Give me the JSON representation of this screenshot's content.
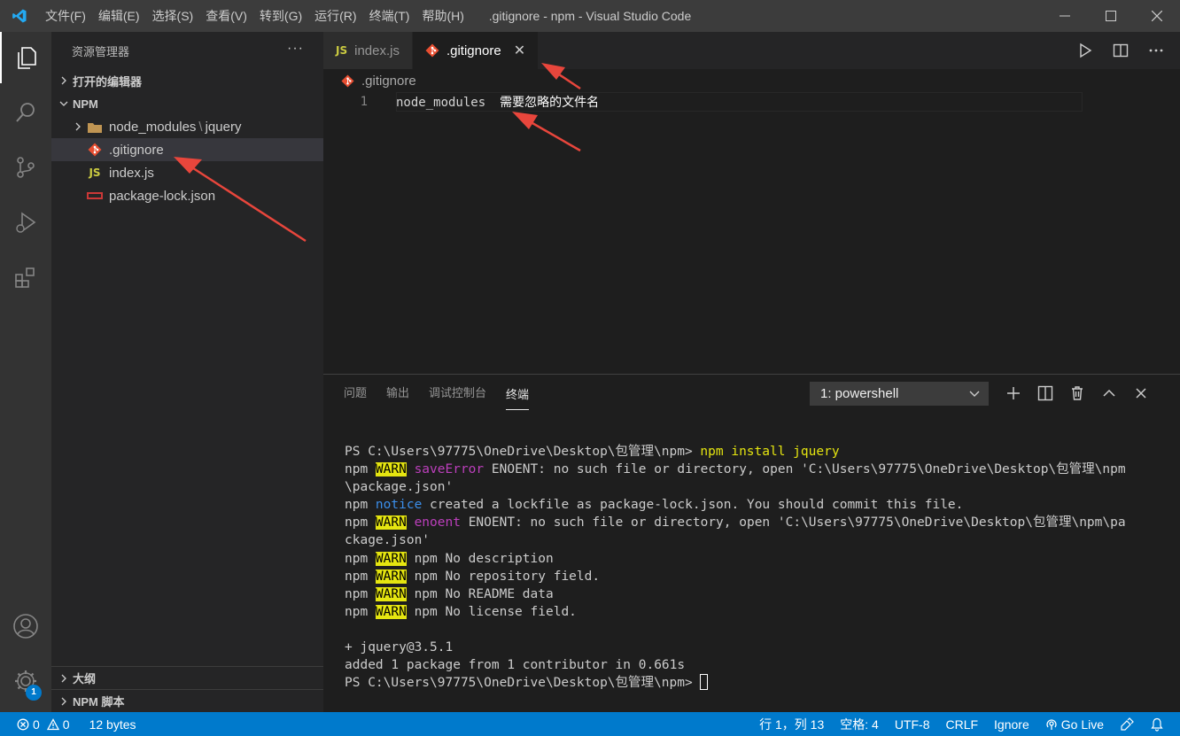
{
  "titlebar": {
    "menu": [
      "文件(F)",
      "编辑(E)",
      "选择(S)",
      "查看(V)",
      "转到(G)",
      "运行(R)",
      "终端(T)",
      "帮助(H)"
    ],
    "title": ".gitignore - npm - Visual Studio Code"
  },
  "activitybar": {
    "badge": "1",
    "icons": [
      "files-icon",
      "search-icon",
      "source-control-icon",
      "run-debug-icon",
      "extensions-icon",
      "account-icon",
      "settings-gear-icon"
    ]
  },
  "sidebar": {
    "header": "资源管理器",
    "more": "···",
    "open_editors": "打开的编辑器",
    "folder": "NPM",
    "tree": [
      {
        "name": "node_modules",
        "sub": "jquery",
        "sep": "\\"
      },
      {
        "name": ".gitignore"
      },
      {
        "name": "index.js",
        "badge": "JS"
      },
      {
        "name": "package-lock.json"
      }
    ],
    "outline": "大纲",
    "npm_scripts": "NPM 脚本"
  },
  "editor": {
    "tabs": [
      {
        "label": "index.js",
        "badge": "JS"
      },
      {
        "label": ".gitignore",
        "close": "✕"
      }
    ],
    "breadcrumb": ".gitignore",
    "lines": [
      {
        "num": "1",
        "text": "node_modules",
        "note": "需要忽略的文件名"
      }
    ]
  },
  "panel": {
    "tabs": [
      "问题",
      "输出",
      "调试控制台",
      "终端"
    ],
    "terminal_select": "1: powershell",
    "terminal": {
      "l1_prompt": "PS C:\\Users\\97775\\OneDrive\\Desktop\\包管理\\npm> ",
      "l1_cmd": "npm install jquery",
      "npm": "npm ",
      "warn": "WARN",
      "l2_key": "saveError",
      "l2_rest": " ENOENT: no such file or directory, open 'C:\\Users\\97775\\OneDrive\\Desktop\\包管理\\npm",
      "l3": "\\package.json'",
      "notice": "notice",
      "l4_rest": " created a lockfile as package-lock.json. You should commit this file.",
      "l5_key": "enoent",
      "l5_rest": " ENOENT: no such file or directory, open 'C:\\Users\\97775\\OneDrive\\Desktop\\包管理\\npm\\pa",
      "l6": "ckage.json'",
      "l7_rest": " npm No description",
      "l8_rest": " npm No repository field.",
      "l9_rest": " npm No README data",
      "l10_rest": " npm No license field.",
      "l12": "+ jquery@3.5.1",
      "l13": "added 1 package from 1 contributor in 0.661s",
      "l14_prompt": "PS C:\\Users\\97775\\OneDrive\\Desktop\\包管理\\npm> "
    }
  },
  "statusbar": {
    "errors": "0",
    "warnings": "0",
    "size": "12 bytes",
    "position": "行 1，列 13",
    "spaces": "空格: 4",
    "encoding": "UTF-8",
    "eol": "CRLF",
    "language": "Ignore",
    "golive": "Go Live"
  },
  "colors": {
    "accent": "#007acc",
    "annotation_arrow": "#e8463c",
    "warn_bg": "#e5e510"
  }
}
